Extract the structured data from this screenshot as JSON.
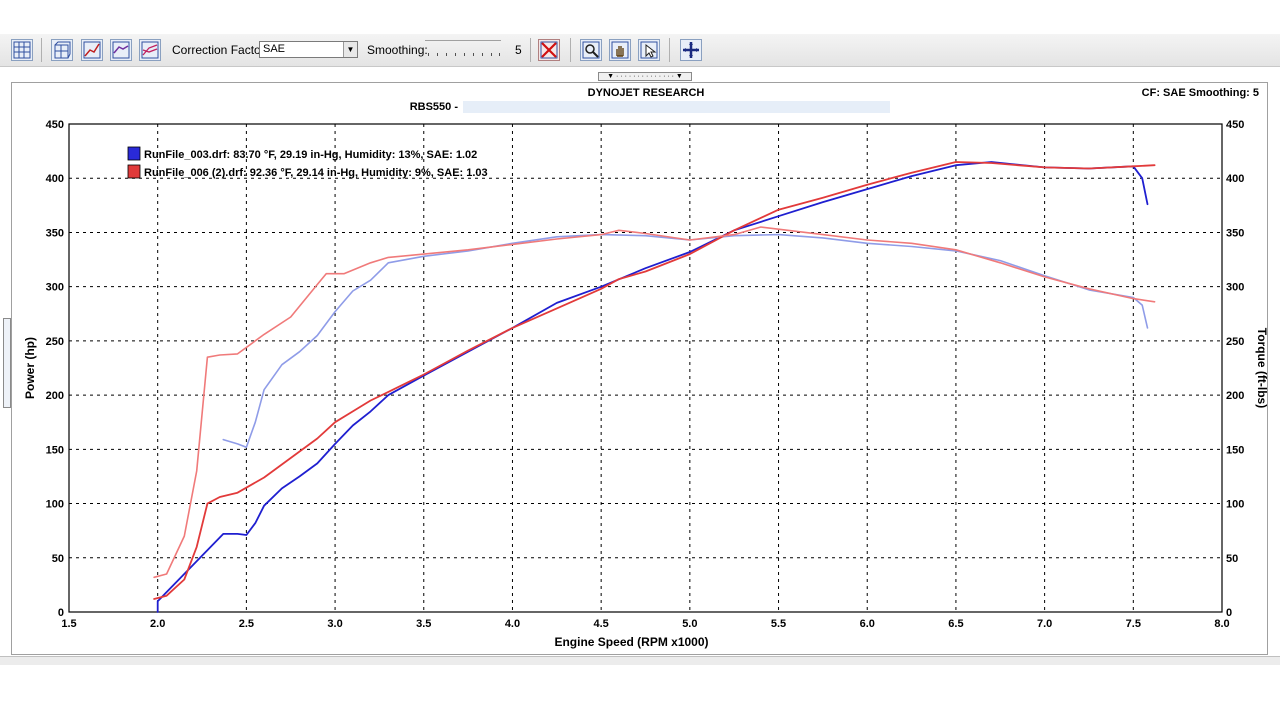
{
  "toolbar": {
    "correction_factor_label": "Correction Factor:",
    "correction_factor_value": "SAE",
    "smoothing_label": "Smoothing:",
    "smoothing_value": "5"
  },
  "header": {
    "title": "DYNOJET RESEARCH",
    "run_label": "RBS550 -",
    "status": "CF: SAE  Smoothing: 5"
  },
  "colors": {
    "blue": "#1f1fd0",
    "red": "#e23a3a",
    "light_blue": "#8f9ce8",
    "light_red": "#f07a7a"
  },
  "chart_data": {
    "type": "line",
    "xlabel": "Engine Speed (RPM x1000)",
    "ylabel": "Power (hp)",
    "y2label": "Torque (ft-lbs)",
    "xlim": [
      1.5,
      8.0
    ],
    "ylim": [
      0,
      450
    ],
    "y2lim": [
      0,
      450
    ],
    "x_ticks": [
      "1.5",
      "2.0",
      "2.5",
      "3.0",
      "3.5",
      "4.0",
      "4.5",
      "5.0",
      "5.5",
      "6.0",
      "6.5",
      "7.0",
      "7.5",
      "8.0"
    ],
    "y_ticks": [
      "0",
      "50",
      "100",
      "150",
      "200",
      "250",
      "300",
      "350",
      "400",
      "450"
    ],
    "grid": true,
    "legend": [
      {
        "text": "RunFile_003.drf: 83.70 °F, 29.19 in-Hg, Humidity: 13%, SAE: 1.02",
        "color": "#2a2ad8"
      },
      {
        "text": "RunFile_006 (2).drf: 92.36 °F, 29.14 in-Hg, Humidity: 9%, SAE: 1.03",
        "color": "#e03a3a"
      }
    ],
    "series": [
      {
        "name": "RunFile_003.drf",
        "measure": "power",
        "color": "#1f1fd0",
        "points": [
          [
            2.0,
            0
          ],
          [
            2.0,
            10
          ],
          [
            2.37,
            72
          ],
          [
            2.45,
            72
          ],
          [
            2.5,
            71
          ],
          [
            2.55,
            82
          ],
          [
            2.6,
            98
          ],
          [
            2.7,
            114
          ],
          [
            2.8,
            125
          ],
          [
            2.9,
            137
          ],
          [
            3.0,
            155
          ],
          [
            3.1,
            172
          ],
          [
            3.2,
            185
          ],
          [
            3.3,
            200
          ],
          [
            3.5,
            218
          ],
          [
            3.75,
            240
          ],
          [
            4.0,
            262
          ],
          [
            4.25,
            285
          ],
          [
            4.5,
            300
          ],
          [
            4.75,
            317
          ],
          [
            5.0,
            332
          ],
          [
            5.25,
            352
          ],
          [
            5.5,
            365
          ],
          [
            5.75,
            378
          ],
          [
            6.0,
            390
          ],
          [
            6.25,
            402
          ],
          [
            6.5,
            412
          ],
          [
            6.7,
            415
          ],
          [
            7.0,
            410
          ],
          [
            7.25,
            409
          ],
          [
            7.5,
            411
          ],
          [
            7.55,
            400
          ],
          [
            7.58,
            376
          ]
        ]
      },
      {
        "name": "RunFile_003.drf",
        "measure": "torque",
        "color": "#8f9ce8",
        "points": [
          [
            2.37,
            159
          ],
          [
            2.45,
            155
          ],
          [
            2.5,
            152
          ],
          [
            2.55,
            175
          ],
          [
            2.6,
            205
          ],
          [
            2.7,
            228
          ],
          [
            2.8,
            240
          ],
          [
            2.9,
            255
          ],
          [
            3.0,
            277
          ],
          [
            3.1,
            296
          ],
          [
            3.2,
            306
          ],
          [
            3.3,
            322
          ],
          [
            3.5,
            328
          ],
          [
            3.75,
            333
          ],
          [
            4.0,
            340
          ],
          [
            4.25,
            346
          ],
          [
            4.5,
            348
          ],
          [
            4.75,
            347
          ],
          [
            5.0,
            343
          ],
          [
            5.25,
            347
          ],
          [
            5.5,
            348
          ],
          [
            5.75,
            345
          ],
          [
            6.0,
            340
          ],
          [
            6.25,
            337
          ],
          [
            6.5,
            333
          ],
          [
            6.75,
            324
          ],
          [
            7.0,
            310
          ],
          [
            7.25,
            297
          ],
          [
            7.5,
            290
          ],
          [
            7.55,
            283
          ],
          [
            7.58,
            262
          ]
        ]
      },
      {
        "name": "RunFile_006 (2).drf",
        "measure": "power",
        "color": "#e23a3a",
        "points": [
          [
            1.98,
            12
          ],
          [
            2.05,
            15
          ],
          [
            2.15,
            30
          ],
          [
            2.22,
            60
          ],
          [
            2.28,
            100
          ],
          [
            2.35,
            106
          ],
          [
            2.45,
            110
          ],
          [
            2.6,
            124
          ],
          [
            2.75,
            142
          ],
          [
            2.9,
            160
          ],
          [
            3.0,
            175
          ],
          [
            3.1,
            185
          ],
          [
            3.2,
            195
          ],
          [
            3.3,
            203
          ],
          [
            3.5,
            219
          ],
          [
            3.75,
            241
          ],
          [
            4.0,
            262
          ],
          [
            4.25,
            280
          ],
          [
            4.5,
            298
          ],
          [
            4.6,
            307
          ],
          [
            4.75,
            314
          ],
          [
            5.0,
            330
          ],
          [
            5.25,
            352
          ],
          [
            5.5,
            371
          ],
          [
            5.75,
            382
          ],
          [
            6.0,
            394
          ],
          [
            6.25,
            405
          ],
          [
            6.5,
            415
          ],
          [
            6.7,
            414
          ],
          [
            7.0,
            410
          ],
          [
            7.25,
            409
          ],
          [
            7.5,
            411
          ],
          [
            7.62,
            412
          ]
        ]
      },
      {
        "name": "RunFile_006 (2).drf",
        "measure": "torque",
        "color": "#f07a7a",
        "points": [
          [
            1.98,
            32
          ],
          [
            2.05,
            35
          ],
          [
            2.15,
            70
          ],
          [
            2.22,
            130
          ],
          [
            2.28,
            235
          ],
          [
            2.35,
            237
          ],
          [
            2.45,
            238
          ],
          [
            2.6,
            256
          ],
          [
            2.75,
            272
          ],
          [
            2.9,
            302
          ],
          [
            2.95,
            312
          ],
          [
            3.05,
            312
          ],
          [
            3.2,
            322
          ],
          [
            3.3,
            327
          ],
          [
            3.5,
            330
          ],
          [
            3.75,
            334
          ],
          [
            4.0,
            339
          ],
          [
            4.25,
            344
          ],
          [
            4.5,
            348
          ],
          [
            4.6,
            352
          ],
          [
            4.75,
            349
          ],
          [
            5.0,
            343
          ],
          [
            5.25,
            348
          ],
          [
            5.4,
            355
          ],
          [
            5.75,
            348
          ],
          [
            6.0,
            343
          ],
          [
            6.25,
            340
          ],
          [
            6.5,
            334
          ],
          [
            6.75,
            322
          ],
          [
            7.0,
            309
          ],
          [
            7.25,
            298
          ],
          [
            7.5,
            289
          ],
          [
            7.62,
            286
          ]
        ]
      }
    ]
  }
}
